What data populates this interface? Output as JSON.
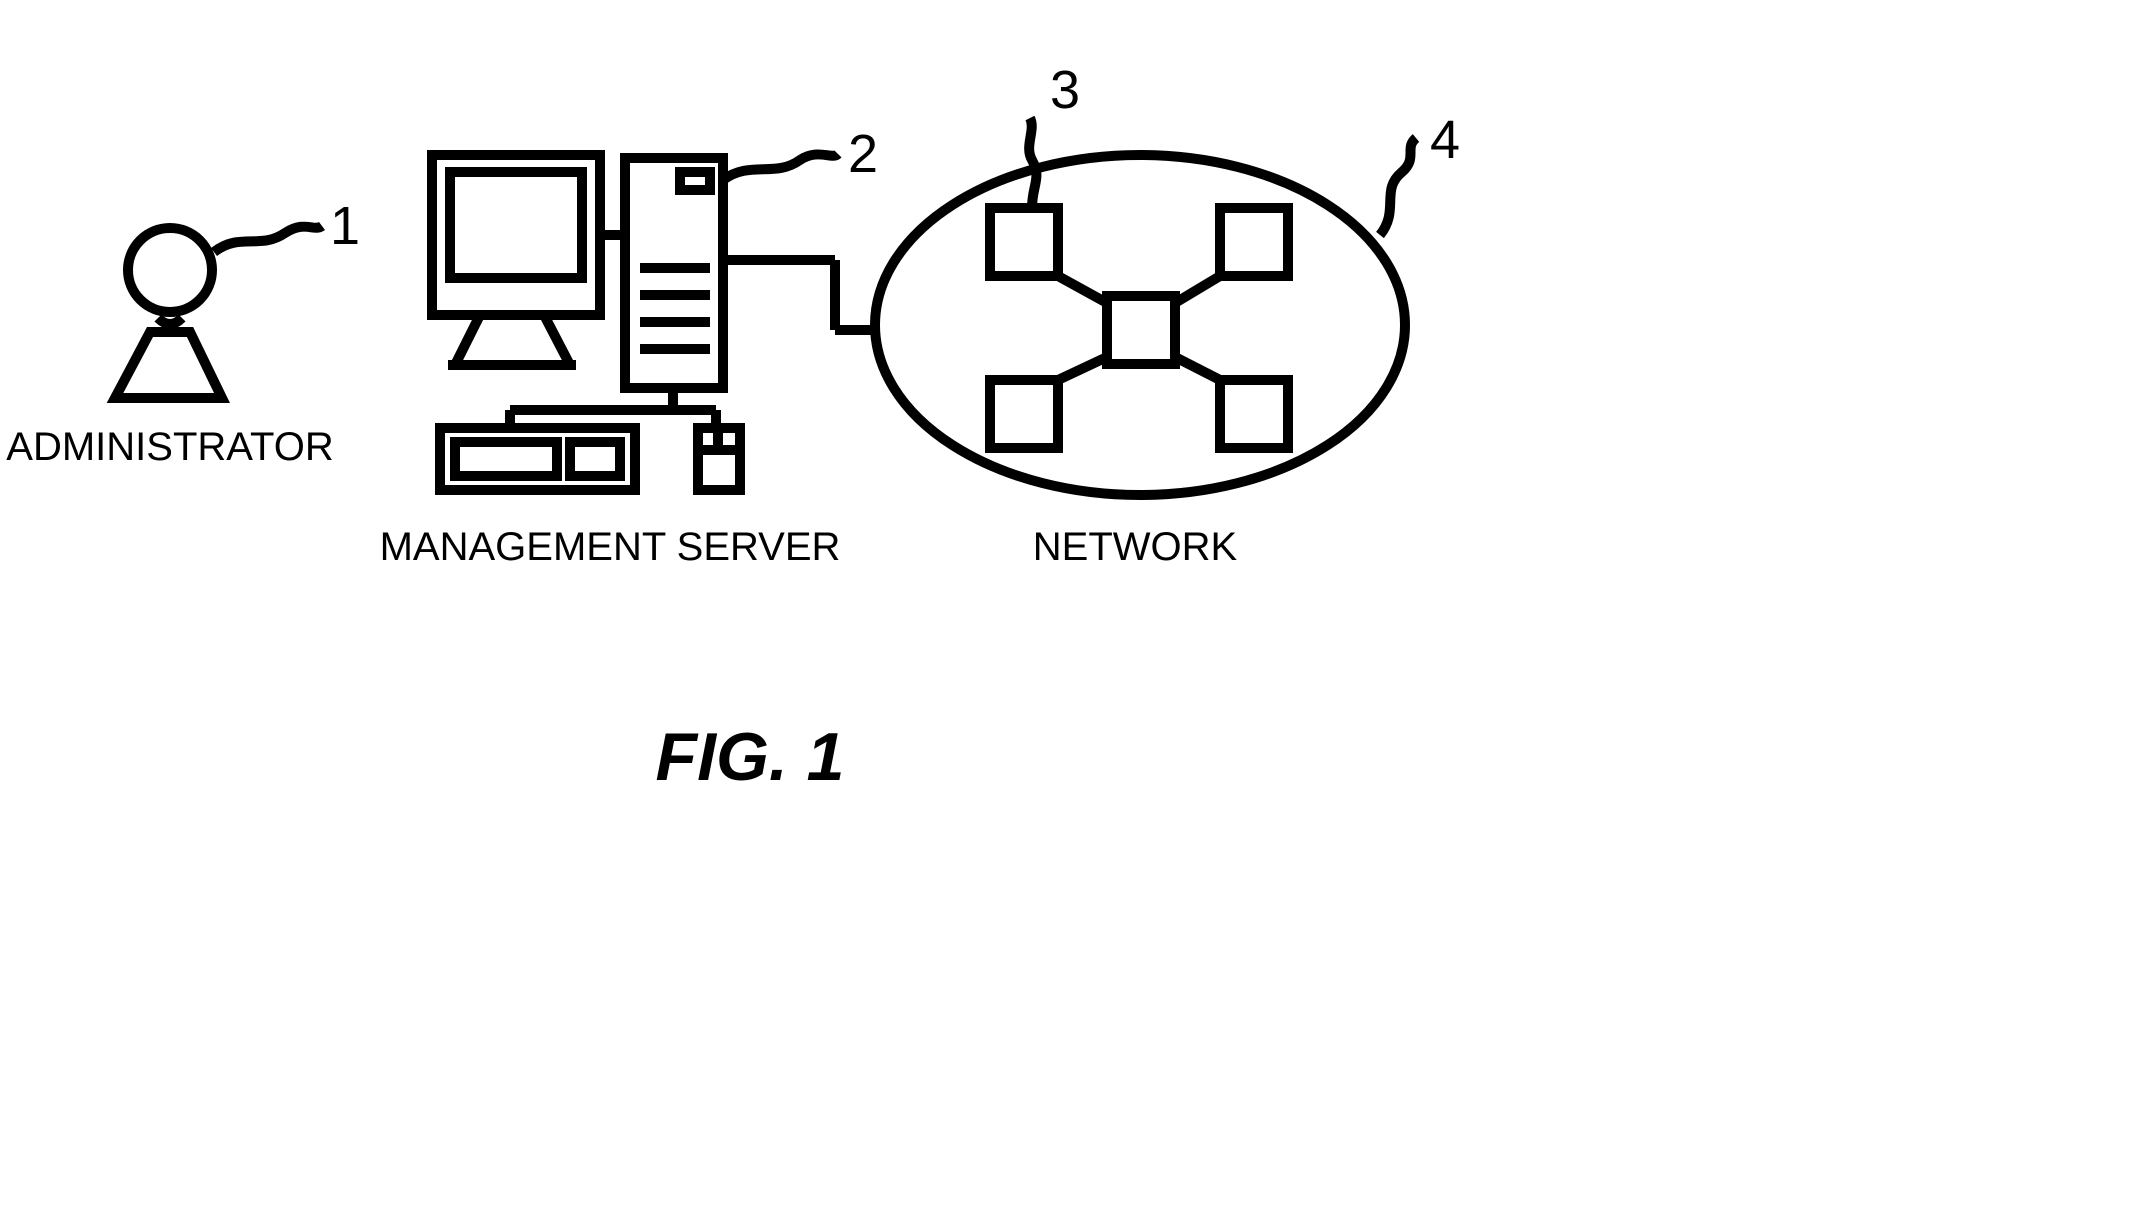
{
  "labels": {
    "administrator": "ADMINISTRATOR",
    "management_server": "MANAGEMENT SERVER",
    "network": "NETWORK"
  },
  "refs": {
    "administrator": "1",
    "server": "2",
    "node": "3",
    "network": "4"
  },
  "caption": "FIG. 1"
}
